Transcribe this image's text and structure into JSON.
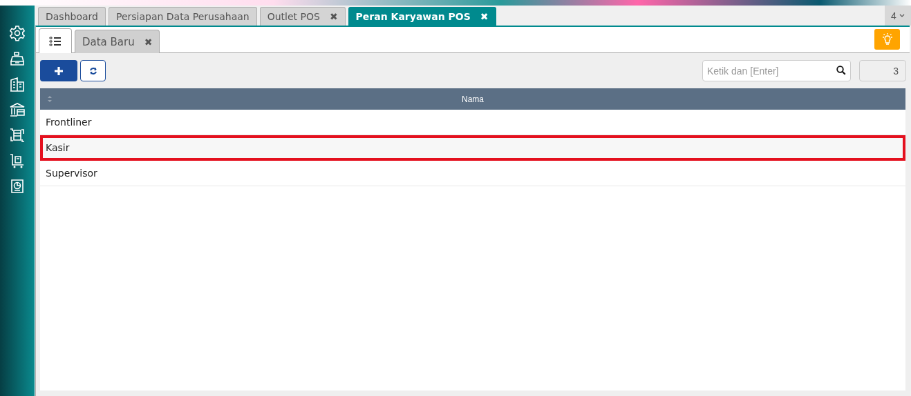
{
  "sidebar": {
    "items": [
      {
        "kind": "gear"
      },
      {
        "kind": "register"
      },
      {
        "kind": "building"
      },
      {
        "kind": "bank"
      },
      {
        "kind": "flow"
      },
      {
        "kind": "cart"
      },
      {
        "kind": "report"
      }
    ]
  },
  "tabs": [
    {
      "label": "Dashboard",
      "selected": false
    },
    {
      "label": "Persiapan Data Perusahaan",
      "selected": false
    },
    {
      "label": "Outlet POS",
      "close": "✖",
      "selected": false
    },
    {
      "label": "Peran Karyawan POS",
      "close": "✖",
      "selected": true
    }
  ],
  "tab_count": "4",
  "subtabs": [
    {
      "kind": "list",
      "selected": true
    },
    {
      "kind": "text",
      "label": "Data Baru",
      "close": "✖",
      "selected": false
    }
  ],
  "search": {
    "placeholder": "Ketik dan [Enter]"
  },
  "record_count": "3",
  "table": {
    "columns": [
      "Nama"
    ],
    "rows": [
      {
        "cells": [
          "Frontliner"
        ],
        "highlighted": false
      },
      {
        "cells": [
          "Kasir"
        ],
        "highlighted": true
      },
      {
        "cells": [
          "Supervisor"
        ],
        "highlighted": false
      }
    ]
  }
}
